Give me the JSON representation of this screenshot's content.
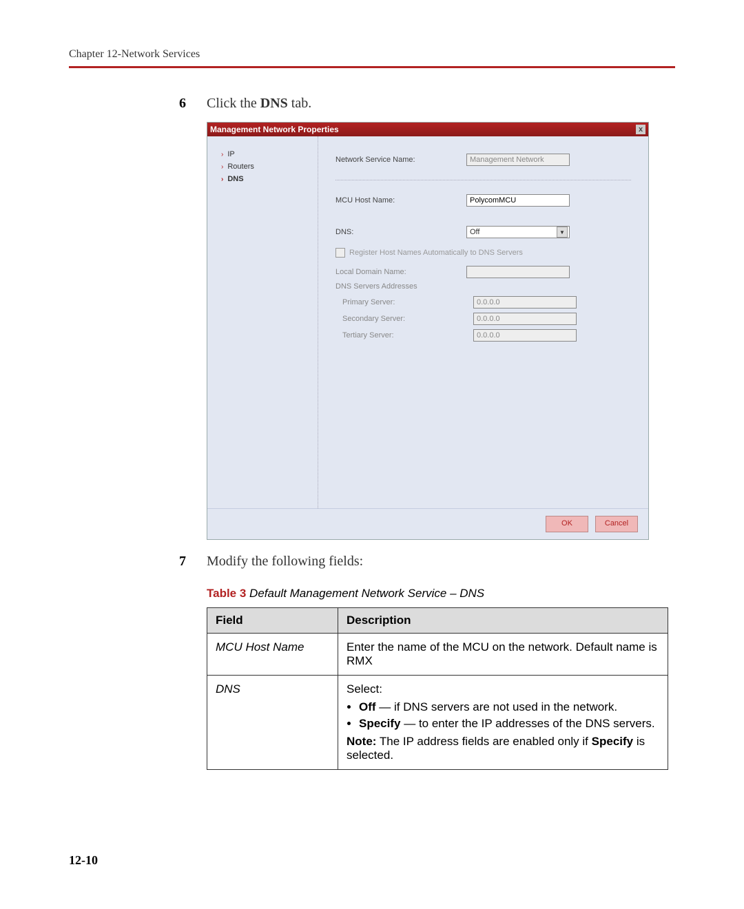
{
  "header": {
    "chapter": "Chapter 12-Network Services"
  },
  "steps": {
    "s6": {
      "num": "6",
      "pre": "Click the ",
      "bold": "DNS",
      "post": " tab."
    },
    "s7": {
      "num": "7",
      "text": "Modify the following fields:"
    }
  },
  "dialog": {
    "title": "Management Network Properties",
    "close": "x",
    "nav": {
      "ip": "IP",
      "routers": "Routers",
      "dns": "DNS"
    },
    "labels": {
      "service_name": "Network Service Name:",
      "mcu_host": "MCU Host Name:",
      "dns": "DNS:",
      "register": "Register Host Names Automatically to DNS Servers",
      "local_domain": "Local Domain Name:",
      "dns_addresses": "DNS Servers Addresses",
      "primary": "Primary Server:",
      "secondary": "Secondary Server:",
      "tertiary": "Tertiary Server:"
    },
    "values": {
      "service_name": "Management Network",
      "mcu_host": "PolycomMCU",
      "dns": "Off",
      "local_domain": "",
      "primary": "0.0.0.0",
      "secondary": "0.0.0.0",
      "tertiary": "0.0.0.0"
    },
    "buttons": {
      "ok": "OK",
      "cancel": "Cancel"
    }
  },
  "table": {
    "caption_prefix": "Table 3",
    "caption_text": " Default Management Network Service – DNS",
    "headers": {
      "field": "Field",
      "desc": "Description"
    },
    "row1": {
      "field": "MCU Host Name",
      "desc": "Enter the name of the MCU on the network. Default name is RMX"
    },
    "row2": {
      "field": "DNS",
      "select": "Select:",
      "b1_bold": "Off",
      "b1_rest": "— if DNS servers are not used in the network.",
      "b2_bold": "Specify",
      "b2_rest": "— to enter the IP addresses of the DNS servers.",
      "note_bold": "Note:",
      "note_rest": " The IP address fields are enabled only if ",
      "note_end_bold": "Specify",
      "note_end_rest": " is selected."
    }
  },
  "page_num": "12-10"
}
